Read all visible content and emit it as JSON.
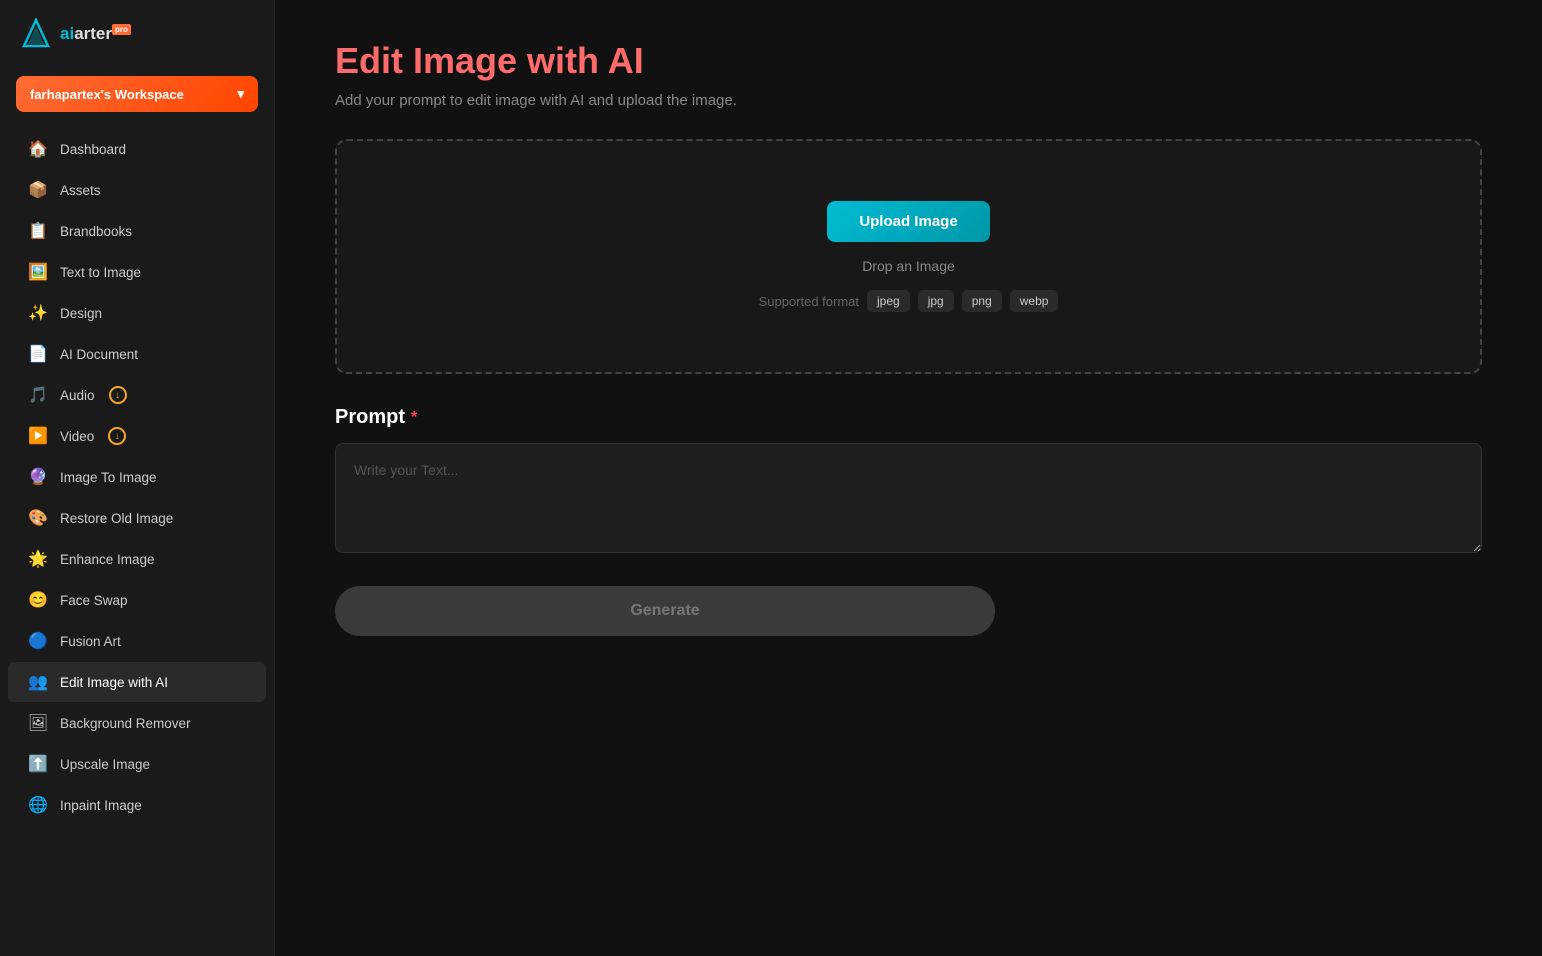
{
  "logo": {
    "text": "aiarter",
    "pro_badge": "pro"
  },
  "workspace": {
    "label": "farhapartex's Workspace",
    "chevron": "▾"
  },
  "nav": {
    "items": [
      {
        "id": "dashboard",
        "label": "Dashboard",
        "icon": "🏠"
      },
      {
        "id": "assets",
        "label": "Assets",
        "icon": "📦"
      },
      {
        "id": "brandbooks",
        "label": "Brandbooks",
        "icon": "📋"
      },
      {
        "id": "text-to-image",
        "label": "Text to Image",
        "icon": "🖼️"
      },
      {
        "id": "design",
        "label": "Design",
        "icon": "✨"
      },
      {
        "id": "ai-document",
        "label": "AI Document",
        "icon": "📄"
      },
      {
        "id": "audio",
        "label": "Audio",
        "icon": "🎵",
        "badge": true
      },
      {
        "id": "video",
        "label": "Video",
        "icon": "▶️",
        "badge": true
      },
      {
        "id": "image-to-image",
        "label": "Image To Image",
        "icon": "🔮"
      },
      {
        "id": "restore-old-image",
        "label": "Restore Old Image",
        "icon": "🎨"
      },
      {
        "id": "enhance-image",
        "label": "Enhance Image",
        "icon": "🌟"
      },
      {
        "id": "face-swap",
        "label": "Face Swap",
        "icon": "😊"
      },
      {
        "id": "fusion-art",
        "label": "Fusion Art",
        "icon": "🔵"
      },
      {
        "id": "edit-image-with-ai",
        "label": "Edit Image with AI",
        "icon": "👥",
        "active": true
      },
      {
        "id": "background-remover",
        "label": "Background Remover",
        "icon": "🖼"
      },
      {
        "id": "upscale-image",
        "label": "Upscale Image",
        "icon": "⬆️"
      },
      {
        "id": "inpaint-image",
        "label": "Inpaint Image",
        "icon": "🌐"
      }
    ]
  },
  "page": {
    "title": "Edit Image with AI",
    "subtitle": "Add your prompt to edit image with AI and upload the image."
  },
  "upload": {
    "button_label": "Upload Image",
    "drop_text": "Drop an Image",
    "format_label": "Supported format",
    "formats": [
      "jpeg",
      "jpg",
      "png",
      "webp"
    ]
  },
  "prompt": {
    "label": "Prompt",
    "required": "*",
    "placeholder": "Write your Text..."
  },
  "generate": {
    "label": "Generate"
  }
}
